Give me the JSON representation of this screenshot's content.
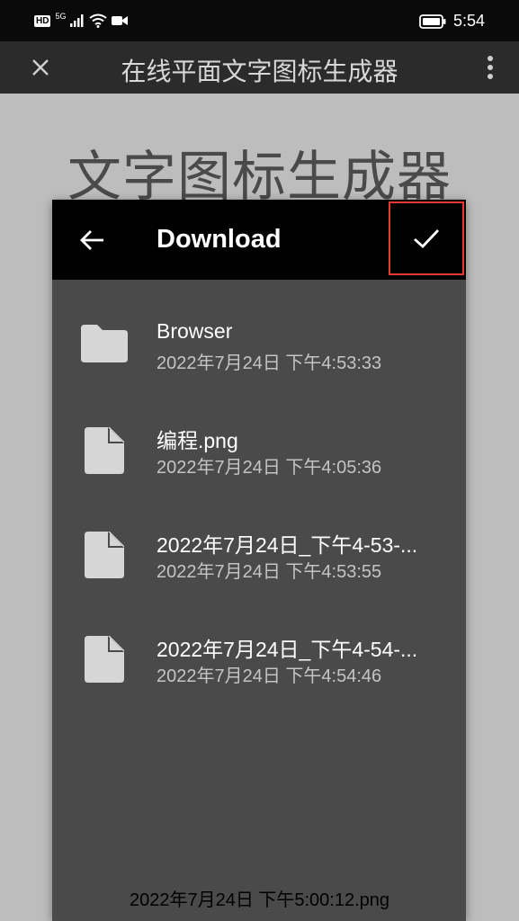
{
  "status_bar": {
    "hd_badge": "HD",
    "network": "5G",
    "time": "5:54",
    "icons": [
      "signal-icon",
      "wifi-icon",
      "video-camera-icon",
      "battery-icon"
    ]
  },
  "app_bar": {
    "title": "在线平面文字图标生成器",
    "icons": [
      "close-icon",
      "more-vertical-icon"
    ]
  },
  "page": {
    "heading": "文字图标生成器"
  },
  "dialog": {
    "title": "Download",
    "icons": [
      "back-arrow-icon",
      "check-icon"
    ],
    "highlight_color": "#e53935",
    "files": [
      {
        "type": "folder",
        "icon": "folder-icon",
        "name": "Browser",
        "date": "2022年7月24日 下午4:53:33"
      },
      {
        "type": "file",
        "icon": "file-icon",
        "name": "编程.png",
        "date": "2022年7月24日 下午4:05:36"
      },
      {
        "type": "file",
        "icon": "file-icon",
        "name": "2022年7月24日_下午4-53-...",
        "date": "2022年7月24日 下午4:53:55"
      },
      {
        "type": "file",
        "icon": "file-icon",
        "name": "2022年7月24日_下午4-54-...",
        "date": "2022年7月24日 下午4:54:46"
      }
    ]
  },
  "footer": {
    "filename": "2022年7月24日 下午5:00:12.png"
  }
}
